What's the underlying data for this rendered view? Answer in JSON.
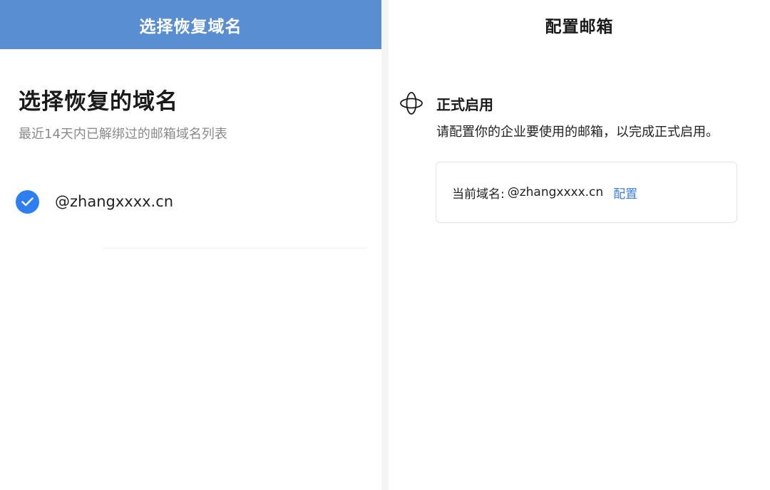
{
  "left": {
    "header_title": "选择恢复域名",
    "section_title": "选择恢复的域名",
    "section_subtitle": "最近14天内已解绑过的邮箱域名列表",
    "options": [
      {
        "label": "@zhangxxxx.cn",
        "checked": true
      }
    ],
    "check_icon": "check-circle-icon",
    "accent_color": "#5b8ed1",
    "check_color": "#2f7ef0"
  },
  "right": {
    "header_title": "配置邮箱",
    "status_icon": "orbit-icon",
    "status_title": "正式启用",
    "status_description": "请配置你的企业要使用的邮箱，以完成正式启用。",
    "card": {
      "label": "当前域名:",
      "value": "@zhangxxxx.cn",
      "link": "配置"
    },
    "link_color": "#3d7ee0"
  }
}
